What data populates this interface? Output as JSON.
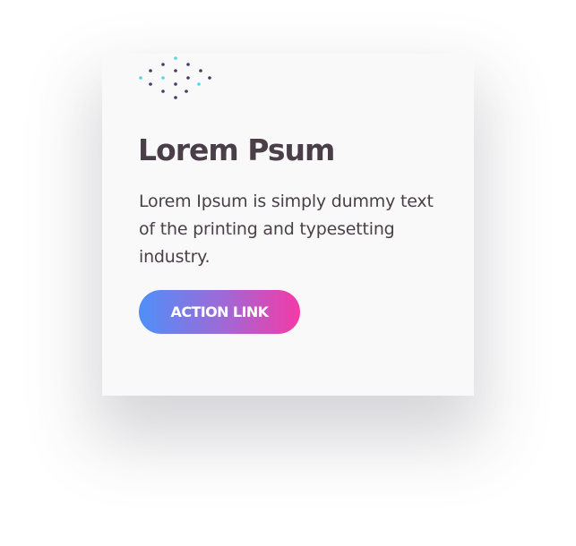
{
  "card": {
    "title": "Lorem Psum",
    "body": "Lorem Ipsum is simply dummy text of the printing and typesetting industry.",
    "action_label": "ACTION LINK"
  },
  "colors": {
    "card_background": "#f9f9f9",
    "text": "#4a3f49",
    "gradient_start": "#4e8ff8",
    "gradient_end": "#f53aa6",
    "dot_dark": "#4a3a66",
    "dot_cyan": "#4fd8ea"
  },
  "icons": {
    "decoration": "dot-diamond-pattern-icon"
  }
}
